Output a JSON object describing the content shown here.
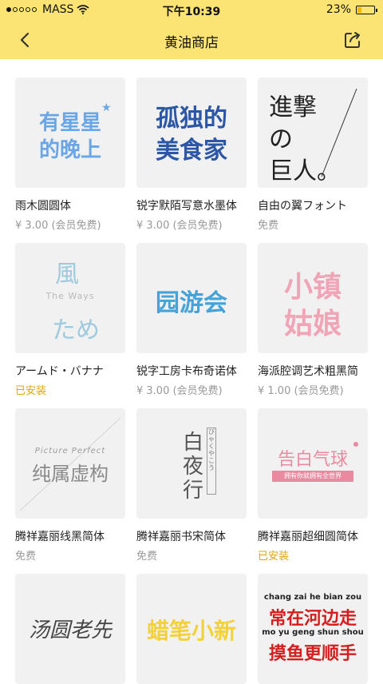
{
  "status_bar": {
    "carrier": "MASS",
    "time": "下午10:39",
    "battery": "23%",
    "battery_level": 0.23
  },
  "nav": {
    "title": "黄油商店",
    "back_icon": "chevron-left-icon",
    "share_icon": "share-icon"
  },
  "fonts": [
    {
      "name": "雨木圆圆体",
      "price": "¥ 3.00 (会员免费)",
      "preview": [
        "有星星",
        "的晚上"
      ],
      "color": "#6aa6e6"
    },
    {
      "name": "锐字默陌写意水墨体",
      "price": "¥ 3.00 (会员免费)",
      "preview": [
        "孤独的",
        "美食家"
      ],
      "color": "#2c56a6"
    },
    {
      "name": "自由の翼フォント",
      "price": "免费",
      "preview": [
        "進撃",
        "の",
        "巨人。"
      ],
      "color": "#222222"
    },
    {
      "name": "アームド・バナナ",
      "price": "已安装",
      "preview": [
        "風",
        "The Ways",
        "ため"
      ],
      "color": "#9fc9dc"
    },
    {
      "name": "锐字工房卡布奇诺体",
      "price": "¥ 3.00 (会员免费)",
      "preview": [
        "园游会"
      ],
      "color": "#45a3d8"
    },
    {
      "name": "海派腔调艺术粗黑简",
      "price": "¥ 1.00 (会员免费)",
      "preview": [
        "小镇",
        "姑娘"
      ],
      "color": "#f1a4b5"
    },
    {
      "name": "腾祥嘉丽线黑简体",
      "price": "免费",
      "preview": [
        "Picture Perfect",
        "纯属虚构"
      ],
      "color": "#8a8a8a"
    },
    {
      "name": "腾祥嘉丽书宋简体",
      "price": "免费",
      "preview": [
        "白夜行",
        "びゃくやこう"
      ],
      "color": "#555555"
    },
    {
      "name": "腾祥嘉丽超细圆简体",
      "price": "已安装",
      "preview": [
        "告白气球",
        "拥有你就拥有全世界"
      ],
      "color": "#ea8aa1"
    },
    {
      "name": "",
      "price": "",
      "preview": [
        "汤圆老先"
      ],
      "color": "#444444"
    },
    {
      "name": "",
      "price": "",
      "preview": [
        "蜡笔小新"
      ],
      "color": "#f3d13b"
    },
    {
      "name": "",
      "price": "",
      "preview": [
        "chang zai he bian zou",
        "常在河边走",
        "mo yu geng shun shou",
        "摸鱼更顺手"
      ],
      "color": "#d51e1e"
    }
  ]
}
